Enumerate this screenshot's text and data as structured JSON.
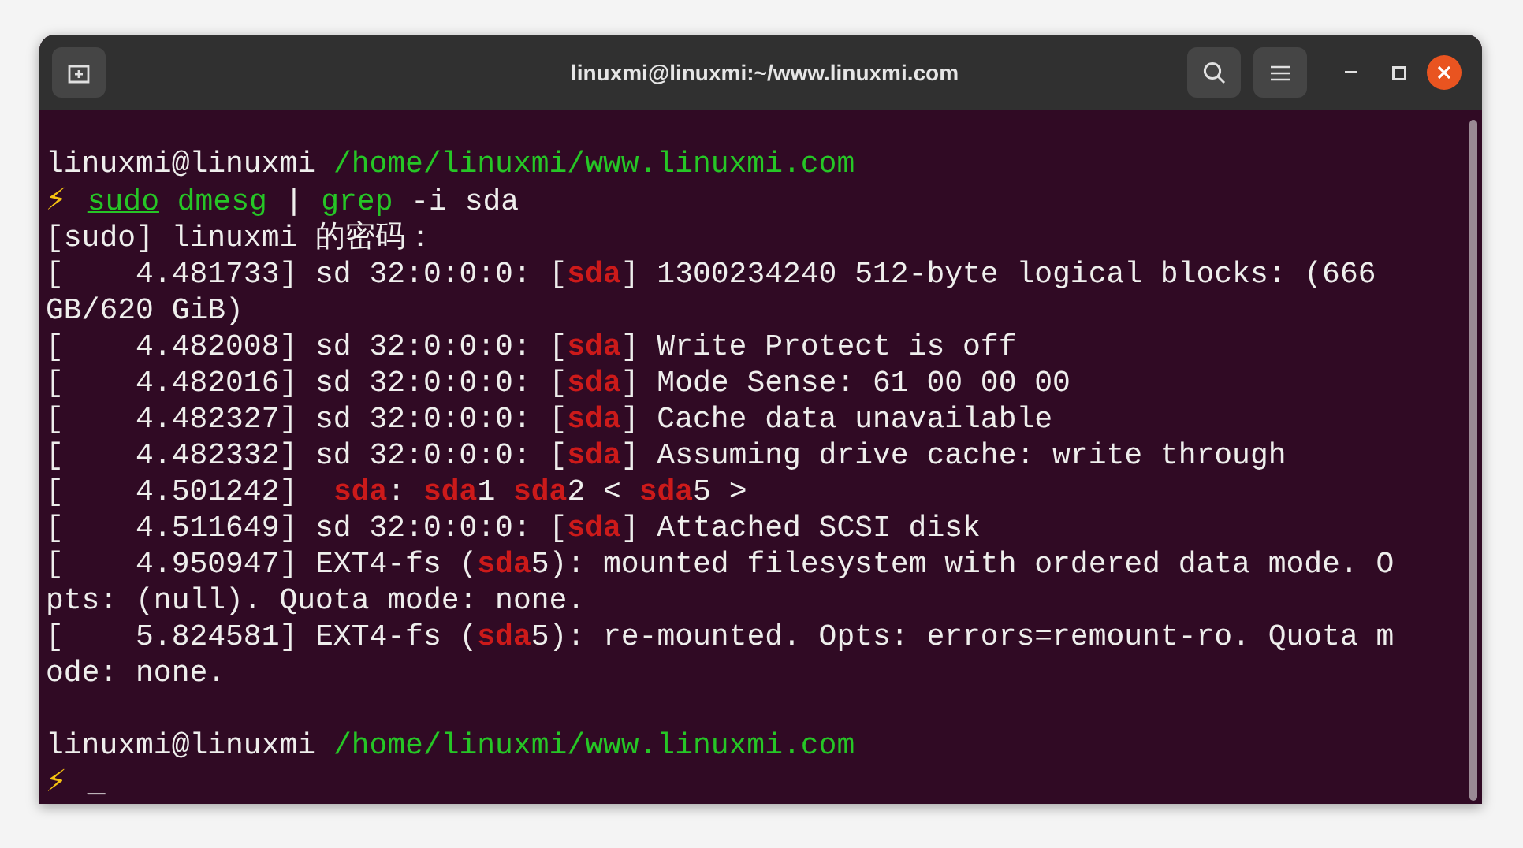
{
  "window": {
    "title": "linuxmi@linuxmi:~/www.linuxmi.com"
  },
  "terminal": {
    "lines": [
      {
        "segments": [
          {
            "kind": "user",
            "text": "linuxmi@linuxmi "
          },
          {
            "kind": "path",
            "text": "/home/linuxmi/www.linuxmi.com"
          }
        ]
      },
      {
        "segments": [
          {
            "kind": "bolt",
            "text": "⚡"
          },
          {
            "kind": "cmd-link",
            "text": "sudo"
          },
          {
            "kind": "cmd",
            "text": "dmesg"
          },
          {
            "kind": "plain",
            "text": " | "
          },
          {
            "kind": "cmd",
            "text": "grep"
          },
          {
            "kind": "plain",
            "text": " -i sda"
          }
        ]
      },
      {
        "segments": [
          {
            "kind": "plain",
            "text": "[sudo] linuxmi 的密码："
          }
        ]
      },
      {
        "segments": [
          {
            "kind": "plain",
            "text": "[    4.481733] sd 32:0:0:0: ["
          },
          {
            "kind": "sda",
            "text": "sda"
          },
          {
            "kind": "plain",
            "text": "] 1300234240 512-byte logical blocks: (666"
          }
        ]
      },
      {
        "segments": [
          {
            "kind": "plain",
            "text": "GB/620 GiB)"
          }
        ]
      },
      {
        "segments": [
          {
            "kind": "plain",
            "text": "[    4.482008] sd 32:0:0:0: ["
          },
          {
            "kind": "sda",
            "text": "sda"
          },
          {
            "kind": "plain",
            "text": "] Write Protect is off"
          }
        ]
      },
      {
        "segments": [
          {
            "kind": "plain",
            "text": "[    4.482016] sd 32:0:0:0: ["
          },
          {
            "kind": "sda",
            "text": "sda"
          },
          {
            "kind": "plain",
            "text": "] Mode Sense: 61 00 00 00"
          }
        ]
      },
      {
        "segments": [
          {
            "kind": "plain",
            "text": "[    4.482327] sd 32:0:0:0: ["
          },
          {
            "kind": "sda",
            "text": "sda"
          },
          {
            "kind": "plain",
            "text": "] Cache data unavailable"
          }
        ]
      },
      {
        "segments": [
          {
            "kind": "plain",
            "text": "[    4.482332] sd 32:0:0:0: ["
          },
          {
            "kind": "sda",
            "text": "sda"
          },
          {
            "kind": "plain",
            "text": "] Assuming drive cache: write through"
          }
        ]
      },
      {
        "segments": [
          {
            "kind": "plain",
            "text": "[    4.501242]  "
          },
          {
            "kind": "sda",
            "text": "sda"
          },
          {
            "kind": "plain",
            "text": ": "
          },
          {
            "kind": "sda",
            "text": "sda"
          },
          {
            "kind": "plain",
            "text": "1 "
          },
          {
            "kind": "sda",
            "text": "sda"
          },
          {
            "kind": "plain",
            "text": "2 < "
          },
          {
            "kind": "sda",
            "text": "sda"
          },
          {
            "kind": "plain",
            "text": "5 >"
          }
        ]
      },
      {
        "segments": [
          {
            "kind": "plain",
            "text": "[    4.511649] sd 32:0:0:0: ["
          },
          {
            "kind": "sda",
            "text": "sda"
          },
          {
            "kind": "plain",
            "text": "] Attached SCSI disk"
          }
        ]
      },
      {
        "segments": [
          {
            "kind": "plain",
            "text": "[    4.950947] EXT4-fs ("
          },
          {
            "kind": "sda",
            "text": "sda"
          },
          {
            "kind": "plain",
            "text": "5): mounted filesystem with ordered data mode. O"
          }
        ]
      },
      {
        "segments": [
          {
            "kind": "plain",
            "text": "pts: (null). Quota mode: none."
          }
        ]
      },
      {
        "segments": [
          {
            "kind": "plain",
            "text": "[    5.824581] EXT4-fs ("
          },
          {
            "kind": "sda",
            "text": "sda"
          },
          {
            "kind": "plain",
            "text": "5): re-mounted. Opts: errors=remount-ro. Quota m"
          }
        ]
      },
      {
        "segments": [
          {
            "kind": "plain",
            "text": "ode: none."
          }
        ]
      }
    ],
    "next_prompt": [
      {
        "segments": [
          {
            "kind": "user",
            "text": "linuxmi@linuxmi "
          },
          {
            "kind": "path",
            "text": "/home/linuxmi/www.linuxmi.com"
          }
        ]
      },
      {
        "segments": [
          {
            "kind": "bolt",
            "text": "⚡"
          },
          {
            "kind": "plain",
            "text": "_"
          }
        ]
      }
    ]
  }
}
